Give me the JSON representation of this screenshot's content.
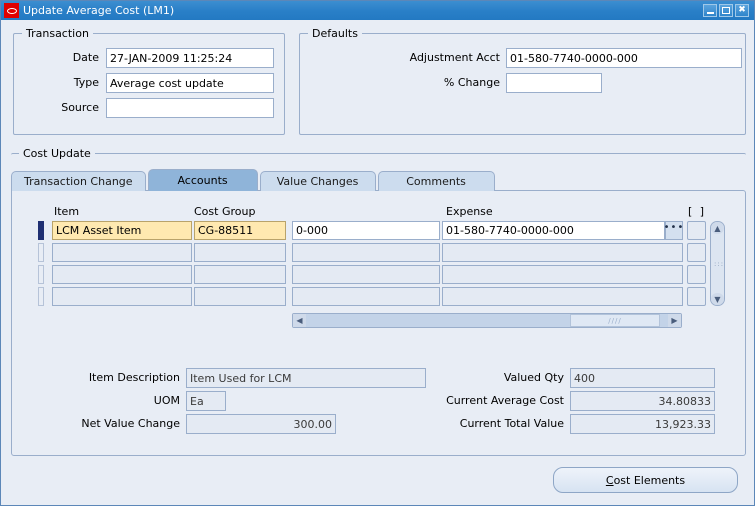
{
  "window": {
    "title": "Update Average Cost (LM1)",
    "logo_icon": "oracle-logo-icon",
    "minimize_label": "",
    "maximize_label": "",
    "close_label": "✖",
    "accent_color": "#2a80c8",
    "background_color": "#e8edf5",
    "highlight_color": "#ffe9b0"
  },
  "transaction": {
    "legend": "Transaction",
    "fields": [
      {
        "label": "Date",
        "value": "27-JAN-2009 11:25:24"
      },
      {
        "label": "Type",
        "value": "Average cost update"
      },
      {
        "label": "Source",
        "value": ""
      }
    ]
  },
  "defaults": {
    "legend": "Defaults",
    "fields": [
      {
        "label": "Adjustment Acct",
        "value": "01-580-7740-0000-000"
      },
      {
        "label": "% Change",
        "value": ""
      }
    ]
  },
  "cost_update": {
    "legend": "Cost Update",
    "tabs": [
      {
        "label": "Transaction Change",
        "active": false
      },
      {
        "label": "Accounts",
        "active": true
      },
      {
        "label": "Value Changes",
        "active": false
      },
      {
        "label": "Comments",
        "active": false
      }
    ],
    "grid": {
      "columns": [
        {
          "header": "Item"
        },
        {
          "header": "Cost Group"
        },
        {
          "header": ""
        },
        {
          "header": "Expense"
        },
        {
          "header": "[   ]"
        }
      ],
      "rows": [
        {
          "item": "LCM Asset Item",
          "cost_group": "CG-88511",
          "account_clipped": "0-000",
          "expense": "01-580-7740-0000-000",
          "current": true
        },
        {
          "item": "",
          "cost_group": "",
          "account_clipped": "",
          "expense": "",
          "current": false
        },
        {
          "item": "",
          "cost_group": "",
          "account_clipped": "",
          "expense": "",
          "current": false
        },
        {
          "item": "",
          "cost_group": "",
          "account_clipped": "",
          "expense": "",
          "current": false
        }
      ],
      "lov_button_label": "•••",
      "scroll_up_glyph": "▲",
      "scroll_down_glyph": "▼",
      "scroll_left_glyph": "◀",
      "scroll_right_glyph": "▶",
      "thumb_grip": "////"
    },
    "detail_left": [
      {
        "label": "Item Description",
        "value": "Item Used for LCM",
        "align": "left"
      },
      {
        "label": "UOM",
        "value": "Ea",
        "align": "left"
      },
      {
        "label": "Net Value Change",
        "value": "300.00",
        "align": "right"
      }
    ],
    "detail_right": [
      {
        "label": "Valued Qty",
        "value": "400",
        "align": "left"
      },
      {
        "label": "Current Average Cost",
        "value": "34.80833",
        "align": "right"
      },
      {
        "label": "Current Total Value",
        "value": "13,923.33",
        "align": "right"
      }
    ]
  },
  "footer": {
    "cost_elements_accel": "C",
    "cost_elements_rest": "ost Elements"
  }
}
